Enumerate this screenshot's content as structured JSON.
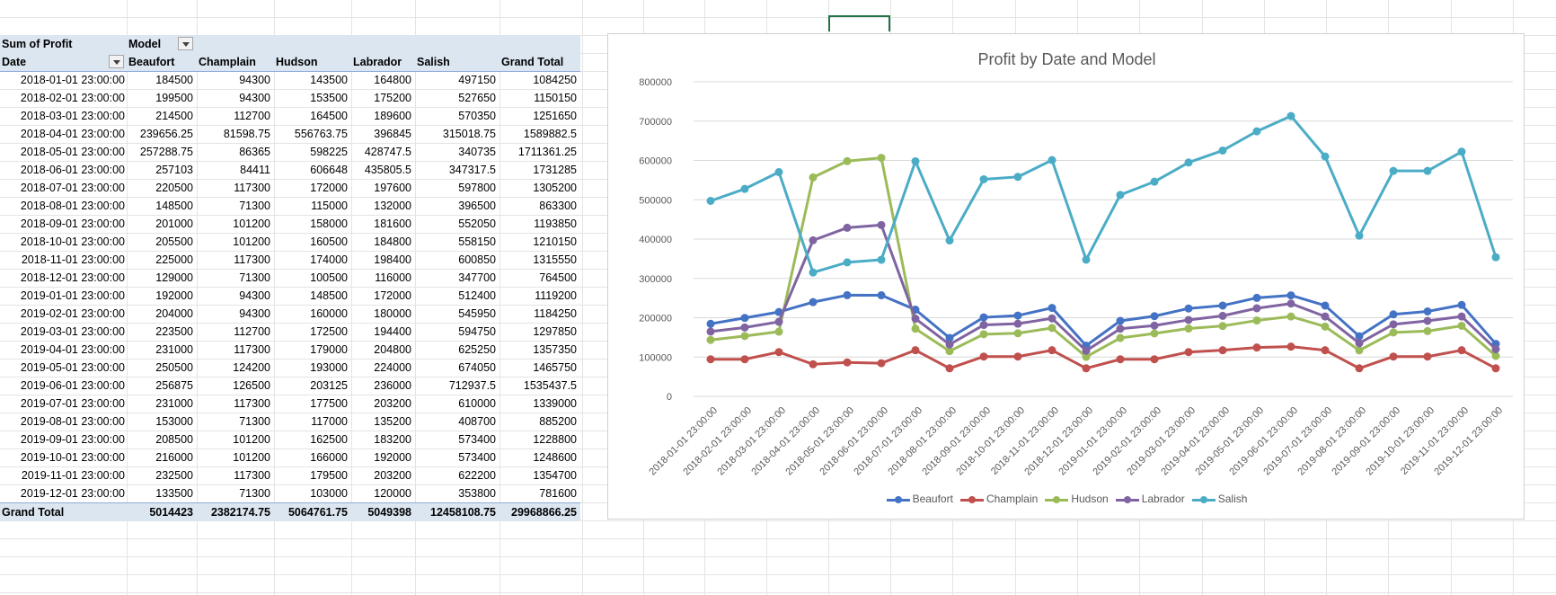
{
  "pivot": {
    "corner_label": "Sum of Profit",
    "column_field": "Model",
    "row_field": "Date",
    "columns": [
      "Beaufort",
      "Champlain",
      "Hudson",
      "Labrador",
      "Salish",
      "Grand Total"
    ],
    "rows": [
      {
        "date": "2018-01-01 23:00:00",
        "values": [
          "184500",
          "94300",
          "143500",
          "164800",
          "497150",
          "1084250"
        ]
      },
      {
        "date": "2018-02-01 23:00:00",
        "values": [
          "199500",
          "94300",
          "153500",
          "175200",
          "527650",
          "1150150"
        ]
      },
      {
        "date": "2018-03-01 23:00:00",
        "values": [
          "214500",
          "112700",
          "164500",
          "189600",
          "570350",
          "1251650"
        ]
      },
      {
        "date": "2018-04-01 23:00:00",
        "values": [
          "239656.25",
          "81598.75",
          "556763.75",
          "396845",
          "315018.75",
          "1589882.5"
        ]
      },
      {
        "date": "2018-05-01 23:00:00",
        "values": [
          "257288.75",
          "86365",
          "598225",
          "428747.5",
          "340735",
          "1711361.25"
        ]
      },
      {
        "date": "2018-06-01 23:00:00",
        "values": [
          "257103",
          "84411",
          "606648",
          "435805.5",
          "347317.5",
          "1731285"
        ]
      },
      {
        "date": "2018-07-01 23:00:00",
        "values": [
          "220500",
          "117300",
          "172000",
          "197600",
          "597800",
          "1305200"
        ]
      },
      {
        "date": "2018-08-01 23:00:00",
        "values": [
          "148500",
          "71300",
          "115000",
          "132000",
          "396500",
          "863300"
        ]
      },
      {
        "date": "2018-09-01 23:00:00",
        "values": [
          "201000",
          "101200",
          "158000",
          "181600",
          "552050",
          "1193850"
        ]
      },
      {
        "date": "2018-10-01 23:00:00",
        "values": [
          "205500",
          "101200",
          "160500",
          "184800",
          "558150",
          "1210150"
        ]
      },
      {
        "date": "2018-11-01 23:00:00",
        "values": [
          "225000",
          "117300",
          "174000",
          "198400",
          "600850",
          "1315550"
        ]
      },
      {
        "date": "2018-12-01 23:00:00",
        "values": [
          "129000",
          "71300",
          "100500",
          "116000",
          "347700",
          "764500"
        ]
      },
      {
        "date": "2019-01-01 23:00:00",
        "values": [
          "192000",
          "94300",
          "148500",
          "172000",
          "512400",
          "1119200"
        ]
      },
      {
        "date": "2019-02-01 23:00:00",
        "values": [
          "204000",
          "94300",
          "160000",
          "180000",
          "545950",
          "1184250"
        ]
      },
      {
        "date": "2019-03-01 23:00:00",
        "values": [
          "223500",
          "112700",
          "172500",
          "194400",
          "594750",
          "1297850"
        ]
      },
      {
        "date": "2019-04-01 23:00:00",
        "values": [
          "231000",
          "117300",
          "179000",
          "204800",
          "625250",
          "1357350"
        ]
      },
      {
        "date": "2019-05-01 23:00:00",
        "values": [
          "250500",
          "124200",
          "193000",
          "224000",
          "674050",
          "1465750"
        ]
      },
      {
        "date": "2019-06-01 23:00:00",
        "values": [
          "256875",
          "126500",
          "203125",
          "236000",
          "712937.5",
          "1535437.5"
        ]
      },
      {
        "date": "2019-07-01 23:00:00",
        "values": [
          "231000",
          "117300",
          "177500",
          "203200",
          "610000",
          "1339000"
        ]
      },
      {
        "date": "2019-08-01 23:00:00",
        "values": [
          "153000",
          "71300",
          "117000",
          "135200",
          "408700",
          "885200"
        ]
      },
      {
        "date": "2019-09-01 23:00:00",
        "values": [
          "208500",
          "101200",
          "162500",
          "183200",
          "573400",
          "1228800"
        ]
      },
      {
        "date": "2019-10-01 23:00:00",
        "values": [
          "216000",
          "101200",
          "166000",
          "192000",
          "573400",
          "1248600"
        ]
      },
      {
        "date": "2019-11-01 23:00:00",
        "values": [
          "232500",
          "117300",
          "179500",
          "203200",
          "622200",
          "1354700"
        ]
      },
      {
        "date": "2019-12-01 23:00:00",
        "values": [
          "133500",
          "71300",
          "103000",
          "120000",
          "353800",
          "781600"
        ]
      }
    ],
    "grand_total": {
      "label": "Grand Total",
      "values": [
        "5014423",
        "2382174.75",
        "5064761.75",
        "5049398",
        "12458108.75",
        "29968866.25"
      ]
    }
  },
  "chart_data": {
    "type": "line",
    "title": "Profit by Date and Model",
    "xlabel": "",
    "ylabel": "",
    "ylim": [
      0,
      800000
    ],
    "yticks": [
      "0",
      "100000",
      "200000",
      "300000",
      "400000",
      "500000",
      "600000",
      "700000",
      "800000"
    ],
    "grid": true,
    "legend_position": "bottom",
    "x": [
      "2018-01-01 23:00:00",
      "2018-02-01 23:00:00",
      "2018-03-01 23:00:00",
      "2018-04-01 23:00:00",
      "2018-05-01 23:00:00",
      "2018-06-01 23:00:00",
      "2018-07-01 23:00:00",
      "2018-08-01 23:00:00",
      "2018-09-01 23:00:00",
      "2018-10-01 23:00:00",
      "2018-11-01 23:00:00",
      "2018-12-01 23:00:00",
      "2019-01-01 23:00:00",
      "2019-02-01 23:00:00",
      "2019-03-01 23:00:00",
      "2019-04-01 23:00:00",
      "2019-05-01 23:00:00",
      "2019-06-01 23:00:00",
      "2019-07-01 23:00:00",
      "2019-08-01 23:00:00",
      "2019-09-01 23:00:00",
      "2019-10-01 23:00:00",
      "2019-11-01 23:00:00",
      "2019-12-01 23:00:00"
    ],
    "series": [
      {
        "name": "Beaufort",
        "color": "#4472c4",
        "values": [
          184500,
          199500,
          214500,
          239656.25,
          257288.75,
          257103,
          220500,
          148500,
          201000,
          205500,
          225000,
          129000,
          192000,
          204000,
          223500,
          231000,
          250500,
          256875,
          231000,
          153000,
          208500,
          216000,
          232500,
          133500
        ]
      },
      {
        "name": "Champlain",
        "color": "#c0504d",
        "values": [
          94300,
          94300,
          112700,
          81598.75,
          86365,
          84411,
          117300,
          71300,
          101200,
          101200,
          117300,
          71300,
          94300,
          94300,
          112700,
          117300,
          124200,
          126500,
          117300,
          71300,
          101200,
          101200,
          117300,
          71300
        ]
      },
      {
        "name": "Hudson",
        "color": "#9bbb59",
        "values": [
          143500,
          153500,
          164500,
          556763.75,
          598225,
          606648,
          172000,
          115000,
          158000,
          160500,
          174000,
          100500,
          148500,
          160000,
          172500,
          179000,
          193000,
          203125,
          177500,
          117000,
          162500,
          166000,
          179500,
          103000
        ]
      },
      {
        "name": "Labrador",
        "color": "#8064a2",
        "values": [
          164800,
          175200,
          189600,
          396845,
          428747.5,
          435805.5,
          197600,
          132000,
          181600,
          184800,
          198400,
          116000,
          172000,
          180000,
          194400,
          204800,
          224000,
          236000,
          203200,
          135200,
          183200,
          192000,
          203200,
          120000
        ]
      },
      {
        "name": "Salish",
        "color": "#4bacc6",
        "values": [
          497150,
          527650,
          570350,
          315018.75,
          340735,
          347317.5,
          597800,
          396500,
          552050,
          558150,
          600850,
          347700,
          512400,
          545950,
          594750,
          625250,
          674050,
          712937.5,
          610000,
          408700,
          573400,
          573400,
          622200,
          353800
        ]
      }
    ]
  }
}
